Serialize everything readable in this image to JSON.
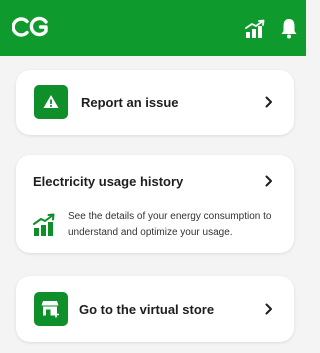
{
  "header": {
    "logo_text": "CG",
    "icons": [
      "usage-chart-icon",
      "bell-icon"
    ]
  },
  "cards": {
    "report_issue": {
      "label": "Report an issue",
      "icon": "warning-icon"
    },
    "usage_history": {
      "title": "Electricity usage history",
      "description": "See the details of your energy consumption to understand and optimize your usage.",
      "icon": "usage-chart-icon"
    },
    "virtual_store": {
      "label": "Go to the virtual store",
      "icon": "store-add-icon"
    }
  },
  "colors": {
    "brand_green": "#0e9a2c",
    "icon_green": "#0f8f29",
    "background": "#f4f4f4",
    "card": "#ffffff"
  }
}
